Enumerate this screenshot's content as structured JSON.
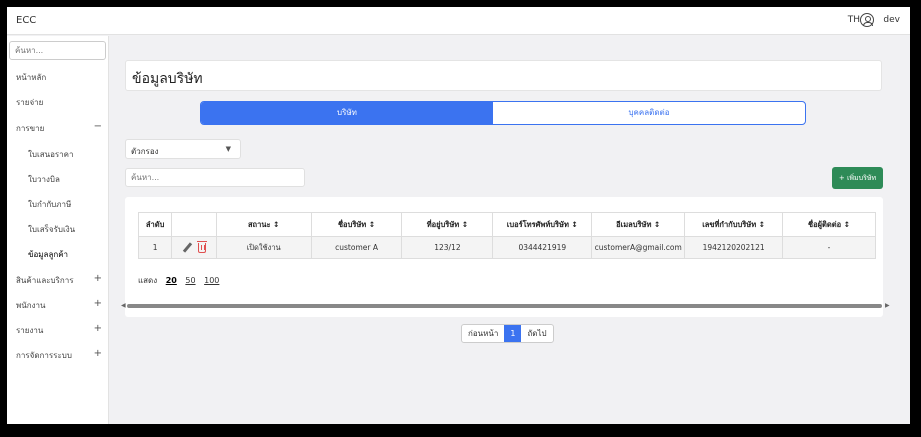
{
  "app": {
    "title": "ECC",
    "lang": "TH",
    "user": "dev"
  },
  "sidebar": {
    "search_placeholder": "ค้นหา...",
    "items": [
      {
        "label": "หน้าหลัก"
      },
      {
        "label": "รายจ่าย"
      },
      {
        "label": "การขาย",
        "sign": "−"
      },
      {
        "label": "สินค้าและบริการ",
        "sign": "+"
      },
      {
        "label": "พนักงาน",
        "sign": "+"
      },
      {
        "label": "รายงาน",
        "sign": "+"
      },
      {
        "label": "การจัดการระบบ",
        "sign": "+"
      }
    ],
    "sub_items": [
      {
        "label": "ใบเสนอราคา"
      },
      {
        "label": "ใบวางบิล"
      },
      {
        "label": "ใบกำกับภาษี"
      },
      {
        "label": "ใบเสร็จรับเงิน"
      },
      {
        "label": "ข้อมูลลูกค้า"
      }
    ]
  },
  "page": {
    "title": "ข้อมูลบริษัท"
  },
  "tabs": [
    {
      "label": "บริษัท"
    },
    {
      "label": "บุคคลติดต่อ"
    }
  ],
  "filter": {
    "label": "ตัวกรอง"
  },
  "search": {
    "placeholder": "ค้นหา..."
  },
  "add_button": {
    "label": "+ เพิ่มบริษัท"
  },
  "table": {
    "headers": [
      "ลำดับ",
      "",
      "สถานะ ↕",
      "ชื่อบริษัท ↕",
      "ที่อยู่บริษัท ↕",
      "เบอร์โทรศัพท์บริษัท ↕",
      "อีเมลบริษัท ↕",
      "เลขที่กำกับบริษัท ↕",
      "ชื่อผู้ติดต่อ ↕"
    ],
    "rows": [
      {
        "no": "1",
        "status": "เปิดใช้งาน",
        "name": "customer A",
        "address": "123/12",
        "phone": "0344421919",
        "email": "customerA@gmail.com",
        "tax_id": "1942120202121",
        "contact": "-"
      }
    ]
  },
  "page_size": {
    "label": "แสดง",
    "options": [
      "20",
      "50",
      "100"
    ],
    "selected": "20"
  },
  "pagination": {
    "prev": "ก่อนหน้า",
    "current": "1",
    "next": "ถัดไป"
  }
}
